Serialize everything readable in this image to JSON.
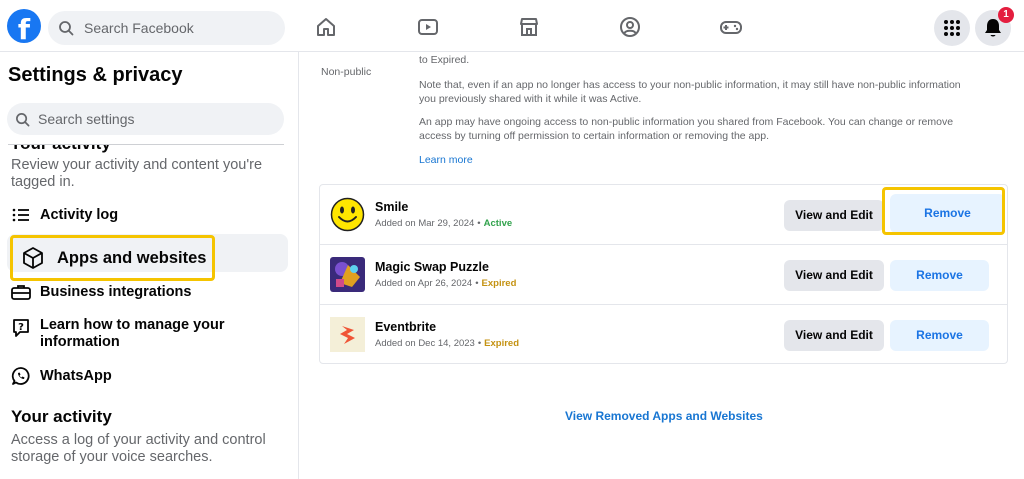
{
  "topbar": {
    "logo": "f",
    "search_placeholder": "Search Facebook",
    "notification_count": "1",
    "icons": [
      "home-icon",
      "watch-icon",
      "marketplace-icon",
      "groups-icon",
      "gaming-icon",
      "menu-grid-icon",
      "notifications-icon"
    ]
  },
  "sidebar": {
    "title": "Settings & privacy",
    "search_placeholder": "Search settings",
    "clipped_heading": "Your activity",
    "activity_desc": "Review your activity and content you're tagged in.",
    "items": [
      {
        "label": "Activity log",
        "icon": "list-icon"
      },
      {
        "label": "Apps and websites",
        "icon": "cube-icon"
      },
      {
        "label": "Business integrations",
        "icon": "briefcase-icon"
      },
      {
        "label": "Learn how to manage your information",
        "icon": "help-chat-icon"
      },
      {
        "label": "WhatsApp",
        "icon": "whatsapp-icon"
      }
    ],
    "section2_heading": "Your activity",
    "section2_desc": "Access a log of your activity and control storage of your voice searches."
  },
  "main": {
    "top_text_partial": "to Expired.",
    "info_label": "Non-public",
    "info_paragraph_1": "Note that, even if an app no longer has access to your non-public information, it may still have non-public information you previously shared with it while it was Active.",
    "info_paragraph_2": "An app may have ongoing access to non-public information you shared from Facebook. You can change or remove access by turning off permission to certain information or removing the app.",
    "learn_more": "Learn more",
    "apps": [
      {
        "name": "Smile",
        "added": "Added on Mar 29, 2024",
        "status": "Active",
        "view_label": "View and Edit",
        "remove_label": "Remove"
      },
      {
        "name": "Magic Swap Puzzle",
        "added": "Added on Apr 26, 2024",
        "status": "Expired",
        "view_label": "View and Edit",
        "remove_label": "Remove"
      },
      {
        "name": "Eventbrite",
        "added": "Added on Dec 14, 2023",
        "status": "Expired",
        "view_label": "View and Edit",
        "remove_label": "Remove"
      }
    ],
    "view_removed": "View Removed Apps and Websites"
  },
  "colors": {
    "brand": "#1877f2",
    "highlight": "#f5c400",
    "active": "#31a24c",
    "expired": "#c49212",
    "link": "#1876d2"
  }
}
